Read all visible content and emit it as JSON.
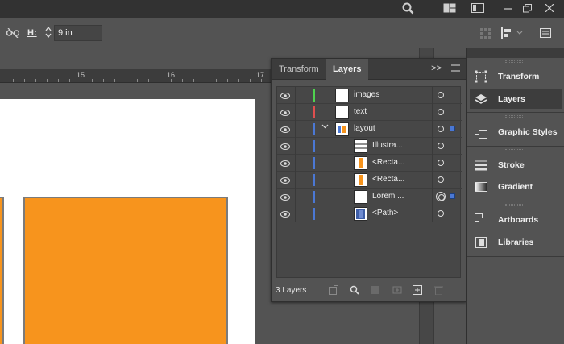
{
  "app_bar": {
    "icons": [
      "search-icon",
      "arrange-documents-icon",
      "workspace-icon",
      "minimize-icon",
      "restore-icon",
      "close-icon"
    ]
  },
  "control_bar": {
    "height_label": "H:",
    "height_value": "9 in"
  },
  "ruler": {
    "labels": [
      "15",
      "16",
      "17"
    ]
  },
  "layers_panel": {
    "tabs": [
      "Transform",
      "Layers"
    ],
    "active_tab": "Layers",
    "more_label": ">>",
    "layer_count": "3 Layers",
    "rows": [
      {
        "name": "images",
        "color": "#4fd24f"
      },
      {
        "name": "text",
        "color": "#e04f4f"
      },
      {
        "name": "layout",
        "color": "#4b78d4"
      },
      {
        "name": "Illustra...",
        "color": "#4b78d4"
      },
      {
        "name": "<Recta...",
        "color": "#4b78d4"
      },
      {
        "name": "<Recta...",
        "color": "#4b78d4"
      },
      {
        "name": "Lorem ...",
        "color": "#4b78d4"
      },
      {
        "name": "<Path>",
        "color": "#4b78d4"
      }
    ]
  },
  "dock": {
    "items": [
      {
        "label": "Transform",
        "icon": "transform-icon"
      },
      {
        "label": "Layers",
        "icon": "layers-icon"
      },
      {
        "label": "Graphic Styles",
        "icon": "graphic-styles-icon"
      },
      {
        "label": "Stroke",
        "icon": "stroke-icon"
      },
      {
        "label": "Gradient",
        "icon": "gradient-icon"
      },
      {
        "label": "Artboards",
        "icon": "artboards-icon"
      },
      {
        "label": "Libraries",
        "icon": "libraries-icon"
      }
    ],
    "active": "Layers"
  },
  "colors": {
    "artwork_orange": "#f7941d",
    "layer_green": "#4fd24f",
    "layer_red": "#e04f4f",
    "layer_blue": "#4b78d4"
  }
}
